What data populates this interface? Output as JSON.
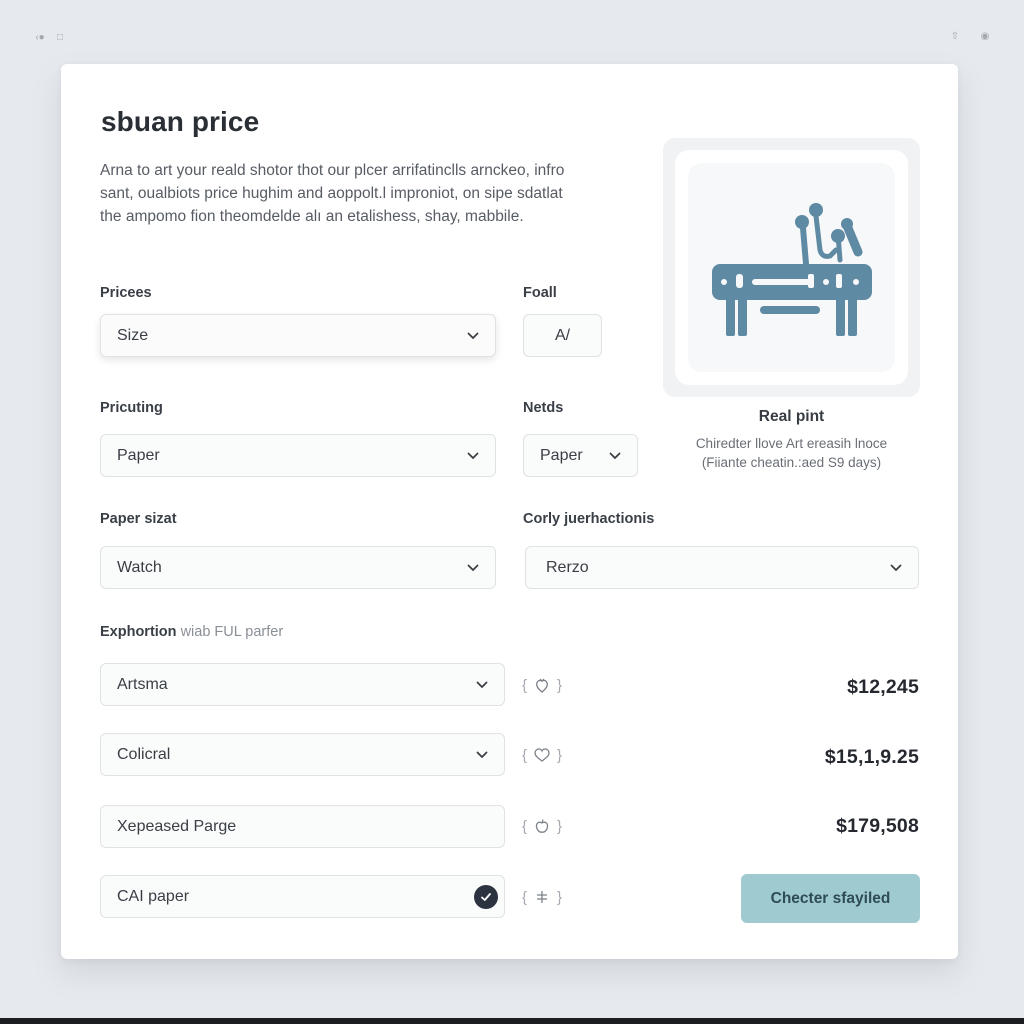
{
  "window": {
    "left_icons": [
      "back-icon",
      "window-icon"
    ],
    "right_icons": [
      "share-icon",
      "profile-icon"
    ]
  },
  "header": {
    "title": "sbuan price",
    "description": "Arna to art your reald shotor thot our plcer arrifatinclls arnckeo, infro sant, oualbiots price hughim and aoppolt.l improniot, on sipe sdatlat the ampomo fion theomdelde alı an etalishess, shay, mabbile."
  },
  "form": {
    "prices": {
      "label": "Pricees",
      "value": "Size"
    },
    "foall": {
      "label": "Foall",
      "value": "A/"
    },
    "pricuting": {
      "label": "Pricuting",
      "value": "Paper"
    },
    "netds": {
      "label": "Netds",
      "value": "Paper"
    },
    "paper_size": {
      "label": "Paper sizat",
      "value": "Watch"
    },
    "corly": {
      "label": "Corly juerhactionis",
      "value": "Rerzo"
    }
  },
  "options": {
    "label": "Exphortion",
    "label_muted": "wiab FUL parfer",
    "rows": [
      {
        "value": "Artsma",
        "type": "select",
        "icon": "strawberry-icon",
        "price": "$12,245"
      },
      {
        "value": "Colicral",
        "type": "select",
        "icon": "heart-icon",
        "price": "$15,1,9.25"
      },
      {
        "value": "Xepeased Parge",
        "type": "text",
        "icon": "apple-icon",
        "price": "$179,508"
      },
      {
        "value": "CAI paper",
        "type": "checked",
        "icon": "plus-minus-icon",
        "price": ""
      }
    ]
  },
  "product": {
    "name": "Real pint",
    "subtitle_line1": "Chiredter llove Art ereasih lnoce",
    "subtitle_line2": "(Fiiante cheatin.:aed S9 days)",
    "image_color": "#5f8aa3"
  },
  "cta": {
    "label": "Checter sfayiled",
    "color": "#9fcbd0"
  }
}
